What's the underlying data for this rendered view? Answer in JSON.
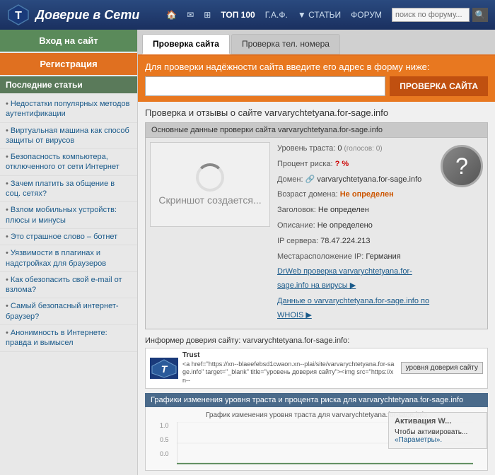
{
  "header": {
    "title": "Доверие в Сети",
    "logo_alt": "T shield logo",
    "nav": {
      "home_label": "🏠",
      "mail_label": "✉",
      "grid_label": "⊞",
      "top100_label": "ТОП 100",
      "faq_label": "Г.А.Ф.",
      "articles_label": "▼ СТАТЬИ",
      "forum_label": "ФОРУМ",
      "search_placeholder": "поиск по форуму...",
      "search_btn_label": "🔍"
    }
  },
  "sidebar": {
    "login_btn": "Вход на сайт",
    "register_btn": "Регистрация",
    "articles_title": "Последние статьи",
    "articles": [
      "Недостатки популярных методов аутентификации",
      "Виртуальная машина как способ защиты от вирусов",
      "Безопасность компьютера, отключенного от сети Интернет",
      "Зачем платить за общение в соц. сетях?",
      "Взлом мобильных устройств: плюсы и минусы",
      "Это страшное слово – ботнет",
      "Уязвимости в плагинах и надстройках для браузеров",
      "Как обезопасить свой e-mail от взлома?",
      "Самый безопасный интернет-браузер?",
      "Анонимность в Интернете: правда и вымысел"
    ]
  },
  "tabs": {
    "check_site_label": "Проверка сайта",
    "check_phone_label": "Проверка тел. номера"
  },
  "banner": {
    "text": "Для проверки надёжности сайта введите его адрес в форму ниже:",
    "input_placeholder": "",
    "btn_label": "ПРОВЕРКА САЙТА"
  },
  "site_info": {
    "title_prefix": "Проверка и отзывы о сайте ",
    "domain": "varvarychtetyana.for-sage.info"
  },
  "trust_box": {
    "header": "Основные данные проверки сайта varvarychtetyana.for-sage.info",
    "screenshot_label": "Скриншот создается...",
    "trust_level_label": "Уровень траста: ",
    "trust_level_value": "0",
    "trust_level_suffix": "(голосов: 0)",
    "risk_label": "Процент риска: ",
    "risk_value": "? %",
    "domain_label": "Домен: ",
    "domain_value": "varvarychtetyana.for-sage.info",
    "domain_icon": "🔗",
    "age_label": "Возраст домена: ",
    "age_value": "Не определен",
    "header_label": "Заголовок: ",
    "header_value": "Не определен",
    "desc_label": "Описание: ",
    "desc_value": "Не определено",
    "ip_label": "IP сервера: ",
    "ip_value": "78.47.224.213",
    "location_label": "Местарасположение IP: ",
    "location_value": "Германия",
    "virus_link": "DrWeb проверка varvarychtetyana.for-sage.info на вирусы ▶",
    "whois_link": "Данные о varvarychtetyana.for-sage.info по WHOIS ▶"
  },
  "informer": {
    "title": "Информер доверия сайту: varvarychtetyana.for-sage.info:",
    "logo_text": "T",
    "code": "<a href=\"https://xn--blaeefebsd1cwaon.xn--plai/site/varvarychtetyana.for-sage.info\" target=\"_blank\" title=\"уровень доверия сайту\"><img src=\"https://xn--",
    "preview_label": "уровня доверия сайту"
  },
  "graph": {
    "header": "Графики изменения уровня траста и процента риска для varvarychtetyana.for-sage.info",
    "title": "График изменения уровня траста для varvarychtetyana.for-sage.info",
    "y_max": "1.0",
    "y_mid": "0.5",
    "y_min": "0.0"
  },
  "windows_overlay": {
    "title": "Активация W...",
    "text": "Чтобы активировать...",
    "link": "«Параметры»."
  }
}
